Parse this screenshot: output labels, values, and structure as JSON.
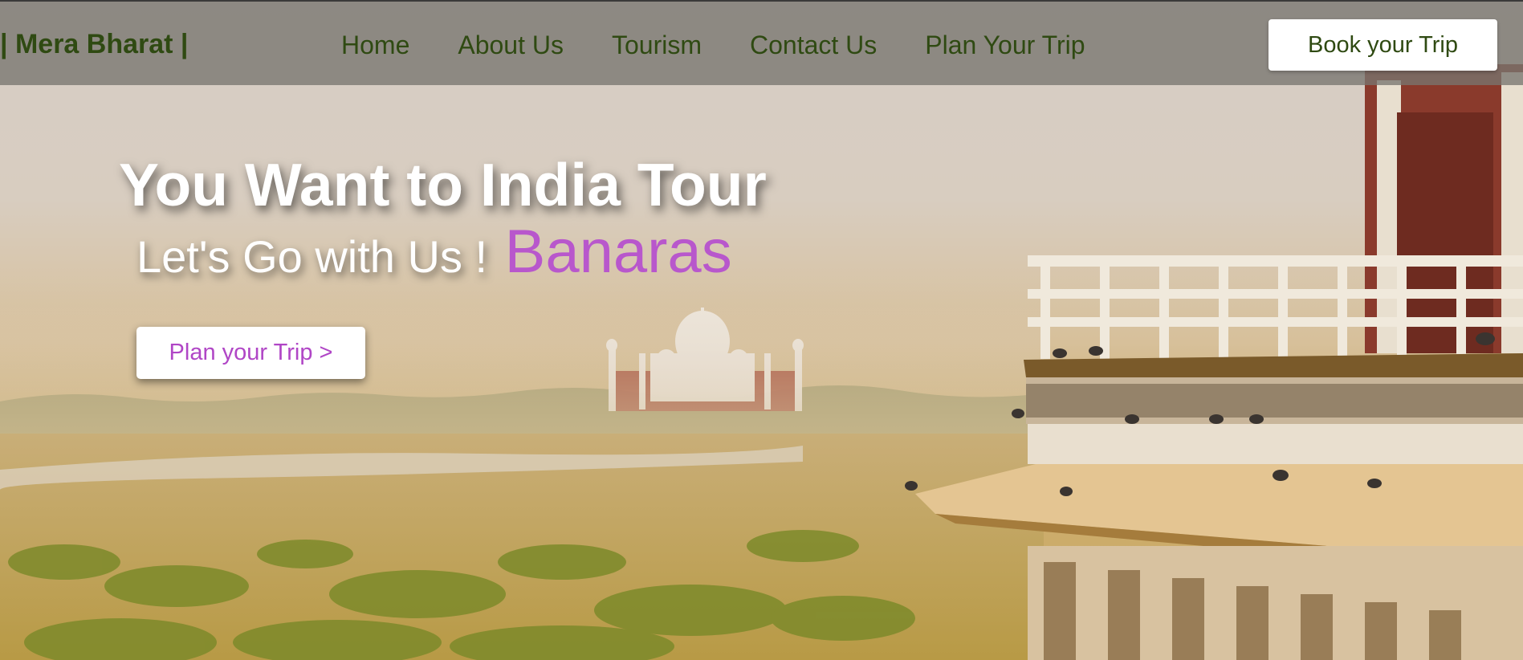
{
  "brand": {
    "name": "| Mera Bharat |"
  },
  "nav": {
    "items": [
      {
        "label": "Home"
      },
      {
        "label": "About Us"
      },
      {
        "label": "Tourism"
      },
      {
        "label": "Contact Us"
      },
      {
        "label": "Plan Your Trip"
      }
    ],
    "cta_label": "Book your Trip"
  },
  "hero": {
    "headline": "You Want to India Tour",
    "subline": "Let's Go with Us !",
    "highlight": "Banaras",
    "button_label": "Plan your Trip >"
  },
  "colors": {
    "brand_text": "#2f4a12",
    "accent": "#b857cc",
    "navbar_bg": "#787670"
  }
}
